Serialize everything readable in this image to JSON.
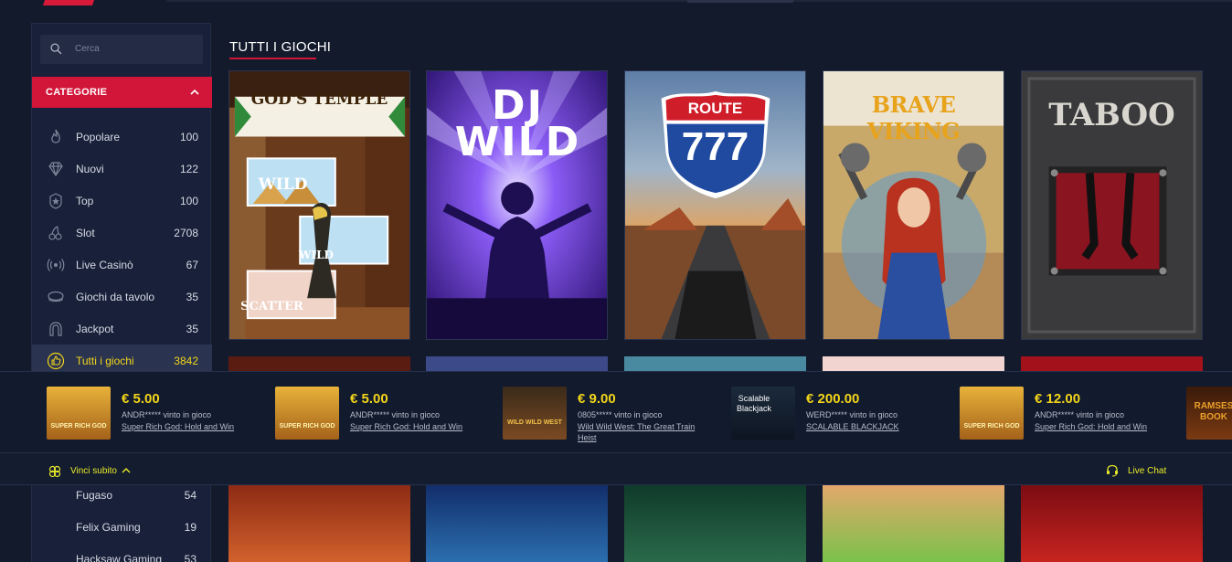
{
  "search": {
    "placeholder": "Cerca"
  },
  "categories": {
    "header": "CATEGORIE",
    "items": [
      {
        "name": "Popolare",
        "count": "100",
        "icon": "flame-icon"
      },
      {
        "name": "Nuovi",
        "count": "122",
        "icon": "diamond-icon"
      },
      {
        "name": "Top",
        "count": "100",
        "icon": "star-badge-icon"
      },
      {
        "name": "Slot",
        "count": "2708",
        "icon": "cherry-icon"
      },
      {
        "name": "Live Casinò",
        "count": "67",
        "icon": "broadcast-icon"
      },
      {
        "name": "Giochi da tavolo",
        "count": "35",
        "icon": "table-icon"
      },
      {
        "name": "Jackpot",
        "count": "35",
        "icon": "horseshoe-icon"
      },
      {
        "name": "Tutti i giochi",
        "count": "3842",
        "icon": "thumbs-up-icon",
        "active": true
      }
    ]
  },
  "providers": [
    {
      "name": "Fugaso",
      "count": "54"
    },
    {
      "name": "Felix Gaming",
      "count": "19"
    },
    {
      "name": "Hacksaw Gaming",
      "count": "53"
    }
  ],
  "main": {
    "title": "TUTTI I GIOCHI",
    "games": [
      {
        "title": "GOD'S TEMPLE",
        "labels": [
          "WILD",
          "WILD",
          "SCATTER"
        ]
      },
      {
        "title": "DJ WILD"
      },
      {
        "title": "ROUTE 777",
        "line1": "ROUTE",
        "line2": "777"
      },
      {
        "title": "BRAVE VIKING"
      },
      {
        "title": "TABOO"
      }
    ]
  },
  "winners": [
    {
      "amount": "€ 5.00",
      "who": "ANDR***** vinto in gioco",
      "game": "Super Rich God: Hold and Win",
      "thumb": "SUPER RICH GOD"
    },
    {
      "amount": "€ 5.00",
      "who": "ANDR***** vinto in gioco",
      "game": "Super Rich God: Hold and Win",
      "thumb": "SUPER RICH GOD"
    },
    {
      "amount": "€ 9.00",
      "who": "0805***** vinto in gioco",
      "game": "Wild Wild West: The Great Train Heist",
      "thumb": "WILD WILD WEST"
    },
    {
      "amount": "€ 200.00",
      "who": "WERD***** vinto in gioco",
      "game": "SCALABLE BLACKJACK",
      "thumb": "Scalable Blackjack"
    },
    {
      "amount": "€ 12.00",
      "who": "ANDR***** vinto in gioco",
      "game": "Super Rich God: Hold and Win",
      "thumb": "SUPER RICH GOD"
    },
    {
      "thumb": "RAMSES BOOK"
    }
  ],
  "footer": {
    "vinci": "Vinci subito",
    "live_chat": "Live Chat"
  },
  "colors": {
    "accent": "#d2163a",
    "highlight": "#f2d51a",
    "bg": "#131a2c",
    "sidebar": "#18203a"
  }
}
